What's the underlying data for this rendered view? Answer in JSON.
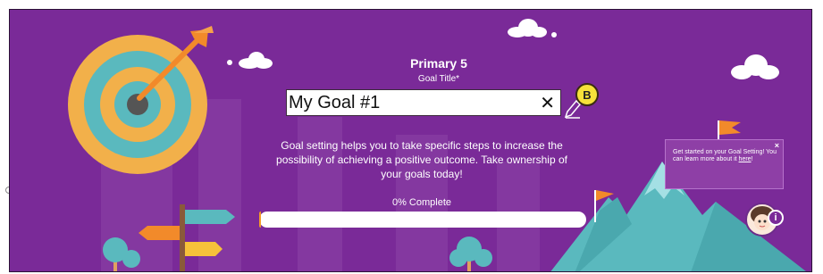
{
  "header": {
    "title": "Primary 5",
    "goal_title_label": "Goal Title*"
  },
  "goal_input": {
    "value": "My Goal #1",
    "clear_symbol": "✕"
  },
  "badge": {
    "label": "B"
  },
  "description": "Goal setting helps you to take specific steps to increase the possibility of achieving a positive outcome. Take ownership of your goals today!",
  "progress": {
    "label": "0% Complete",
    "percent": 0
  },
  "tooltip": {
    "text_before": "Get started on your Goal Setting! You can learn more about it ",
    "link_text": "here",
    "text_after": "!",
    "close_symbol": "×"
  },
  "info_button": {
    "label": "i"
  },
  "colors": {
    "background": "#7a2a98",
    "accent_orange": "#f29a2a",
    "teal": "#5ab9be",
    "badge_yellow": "#f6e23a"
  },
  "icons": [
    "target-icon",
    "arrow-icon",
    "cloud-icon",
    "signpost-icon",
    "tree-icon",
    "mountain-icon",
    "flag-icon",
    "pencil-icon",
    "close-icon",
    "avatar-icon",
    "info-icon"
  ]
}
